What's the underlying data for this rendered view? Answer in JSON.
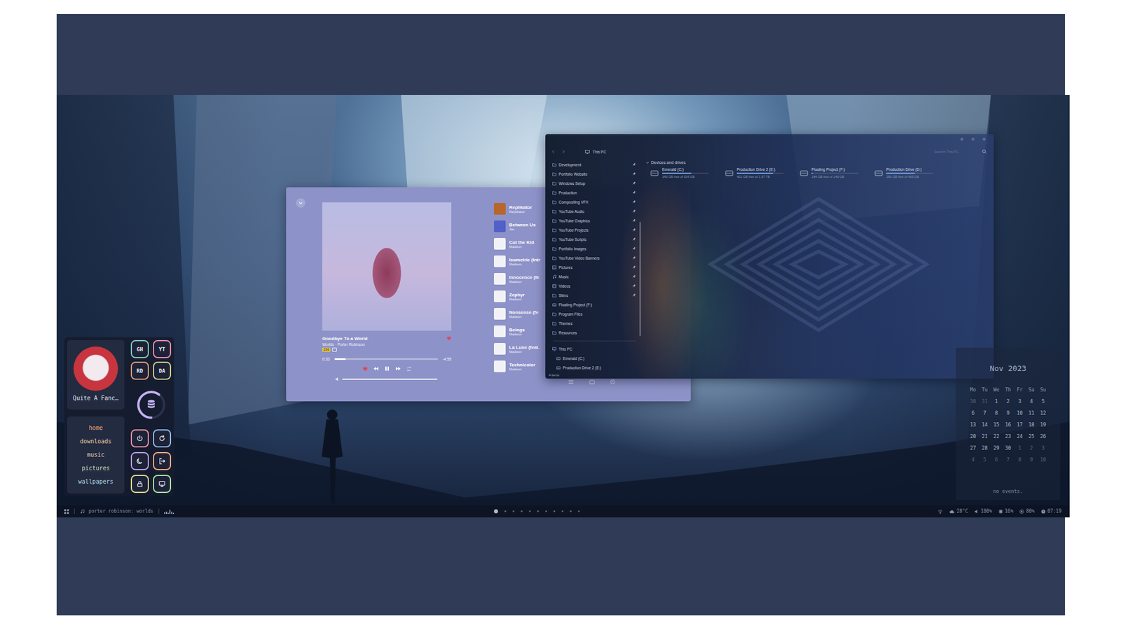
{
  "panel": {
    "profile": {
      "name": "Quite A Fanc…"
    },
    "links": [
      {
        "label": "GH",
        "color": "#7fc9b8"
      },
      {
        "label": "YT",
        "color": "#e58aab"
      },
      {
        "label": "RD",
        "color": "#e39a72"
      },
      {
        "label": "DA",
        "color": "#c6cf88"
      }
    ],
    "storage": {
      "level": 0.6
    },
    "nav": [
      {
        "label": "home",
        "color": "#eba67c"
      },
      {
        "label": "downloads",
        "color": "#e9c9a1"
      },
      {
        "label": "music",
        "color": "#ead3b0"
      },
      {
        "label": "pictures",
        "color": "#d5dcb3"
      },
      {
        "label": "wallpapers",
        "color": "#b3d9e4"
      }
    ],
    "session_buttons": [
      {
        "color": "#e98fa3"
      },
      {
        "color": "#8fb6e8"
      },
      {
        "color": "#b59fe2"
      },
      {
        "color": "#e9a97e"
      },
      {
        "color": "#d7d88f"
      },
      {
        "color": "#a6dfa0"
      }
    ]
  },
  "player": {
    "title": "Goodbye To a World",
    "subtitle": "Worlds · Porter Robinson",
    "badge": "256",
    "liked": true,
    "playing": true,
    "elapsed": "0:33",
    "remaining": "-4:55",
    "progress": 0.11,
    "volume": 1,
    "queue": [
      {
        "title": "Replikator",
        "subtitle": "Replikator",
        "color": "#b8662c"
      },
      {
        "title": "Between Us",
        "subtitle": "Jax",
        "color": "#5260c8"
      },
      {
        "title": "Cut the Kid",
        "subtitle": "Madeon",
        "color": "#f2f2f6"
      },
      {
        "title": "Isometric (Intr",
        "subtitle": "Madeon",
        "color": "#f2f2f6"
      },
      {
        "title": "Innocence (fe",
        "subtitle": "Madeon",
        "color": "#f2f2f6"
      },
      {
        "title": "Zephyr",
        "subtitle": "Madeon",
        "color": "#f2f2f6"
      },
      {
        "title": "Nonsense (fe",
        "subtitle": "Madeon",
        "color": "#f2f2f6"
      },
      {
        "title": "Beings",
        "subtitle": "Madeon",
        "color": "#f2f2f6"
      },
      {
        "title": "La Lune (feat.",
        "subtitle": "Madeon",
        "color": "#f2f2f6"
      },
      {
        "title": "Technicolor",
        "subtitle": "Madeon",
        "color": "#f2f2f6"
      }
    ]
  },
  "explorer": {
    "path": "This PC",
    "search": {
      "placeholder": "Search This PC"
    },
    "sidebar": [
      {
        "label": "Development",
        "kind": "folder",
        "pinned": true
      },
      {
        "label": "Portfolio Website",
        "kind": "folder",
        "pinned": true
      },
      {
        "label": "Windows Setup",
        "kind": "folder",
        "pinned": true
      },
      {
        "label": "Production",
        "kind": "folder",
        "pinned": true
      },
      {
        "label": "Compositing VFX",
        "kind": "folder",
        "pinned": true
      },
      {
        "label": "YouTube Audio",
        "kind": "folder",
        "pinned": true
      },
      {
        "label": "YouTube Graphics",
        "kind": "folder",
        "pinned": true
      },
      {
        "label": "YouTube Projects",
        "kind": "folder",
        "pinned": true
      },
      {
        "label": "YouTube Scripts",
        "kind": "folder",
        "pinned": true
      },
      {
        "label": "Portfolio Images",
        "kind": "folder",
        "pinned": true
      },
      {
        "label": "YouTube Video Banners",
        "kind": "folder",
        "pinned": true
      },
      {
        "label": "Pictures",
        "kind": "pictures",
        "pinned": true
      },
      {
        "label": "Music",
        "kind": "music",
        "pinned": true
      },
      {
        "label": "Videos",
        "kind": "videos",
        "pinned": true
      },
      {
        "label": "Skins",
        "kind": "folder",
        "pinned": true
      },
      {
        "label": "Floating Project (F:)",
        "kind": "drive",
        "pinned": false
      },
      {
        "label": "Program Files",
        "kind": "folder",
        "pinned": false
      },
      {
        "label": "Themes",
        "kind": "folder",
        "pinned": false
      },
      {
        "label": "Resources",
        "kind": "folder",
        "pinned": false
      }
    ],
    "sidebar_drives": [
      {
        "label": "This PC",
        "kind": "pc"
      },
      {
        "label": "Emerald (C:)",
        "kind": "drive"
      },
      {
        "label": "Production Drive 2 (E:)",
        "kind": "drive"
      }
    ],
    "section": {
      "label": "Devices and drives",
      "expanded": true
    },
    "drives": [
      {
        "name": "Emerald (C:)",
        "free": "345 GB free of 936 GB",
        "level": 0.63
      },
      {
        "name": "Production Drive 2 (E:)",
        "free": "401 GB free of 1.67 TB",
        "level": 0.77
      },
      {
        "name": "Floating Project (F:)",
        "free": "144 GB free of 149 GB",
        "level": 0.03
      },
      {
        "name": "Production Drive (D:)",
        "free": "180 GB free of 465 GB",
        "level": 0.61
      }
    ],
    "status": "4 items"
  },
  "calendar": {
    "title": "Nov 2023",
    "weekdays": [
      "Mo",
      "Tu",
      "We",
      "Th",
      "Fr",
      "Sa",
      "Su"
    ],
    "weeks": [
      [
        {
          "day": "30",
          "current": false
        },
        {
          "day": "31",
          "current": false
        },
        {
          "day": "1",
          "current": true
        },
        {
          "day": "2",
          "current": true
        },
        {
          "day": "3",
          "current": true
        },
        {
          "day": "4",
          "current": true
        },
        {
          "day": "5",
          "current": true
        }
      ],
      [
        {
          "day": "6",
          "current": true
        },
        {
          "day": "7",
          "current": true
        },
        {
          "day": "8",
          "current": true
        },
        {
          "day": "9",
          "current": true
        },
        {
          "day": "10",
          "current": true
        },
        {
          "day": "11",
          "current": true
        },
        {
          "day": "12",
          "current": true
        }
      ],
      [
        {
          "day": "13",
          "current": true
        },
        {
          "day": "14",
          "current": true
        },
        {
          "day": "15",
          "current": true
        },
        {
          "day": "16",
          "current": true
        },
        {
          "day": "17",
          "current": true
        },
        {
          "day": "18",
          "current": true
        },
        {
          "day": "19",
          "current": true
        }
      ],
      [
        {
          "day": "20",
          "current": true
        },
        {
          "day": "21",
          "current": true
        },
        {
          "day": "22",
          "current": true
        },
        {
          "day": "23",
          "current": true
        },
        {
          "day": "24",
          "current": true
        },
        {
          "day": "25",
          "current": true
        },
        {
          "day": "26",
          "current": true
        }
      ],
      [
        {
          "day": "27",
          "current": true
        },
        {
          "day": "28",
          "current": true
        },
        {
          "day": "29",
          "current": true
        },
        {
          "day": "30",
          "current": true
        },
        {
          "day": "1",
          "current": false
        },
        {
          "day": "2",
          "current": false
        },
        {
          "day": "3",
          "current": false
        }
      ],
      [
        {
          "day": "4",
          "current": false
        },
        {
          "day": "5",
          "current": false
        },
        {
          "day": "6",
          "current": false
        },
        {
          "day": "7",
          "current": false
        },
        {
          "day": "8",
          "current": false
        },
        {
          "day": "9",
          "current": false
        },
        {
          "day": "10",
          "current": false
        }
      ]
    ],
    "events_text": "no events."
  },
  "taskbar": {
    "separator": "|",
    "now_playing": "porter robinson: worlds",
    "visualizer": [
      0.3,
      0.5,
      0.25,
      0.8,
      0.45,
      0.2
    ],
    "workspaces": [
      {
        "selected": true
      },
      {
        "selected": false
      },
      {
        "selected": false
      },
      {
        "selected": false
      },
      {
        "selected": false
      },
      {
        "selected": false
      },
      {
        "selected": false
      },
      {
        "selected": false
      },
      {
        "selected": false
      },
      {
        "selected": false
      },
      {
        "selected": false
      }
    ],
    "status": [
      {
        "kind": "weather",
        "text": "28°C"
      },
      {
        "kind": "volume",
        "text": "100%"
      },
      {
        "kind": "cpu",
        "text": "16%"
      },
      {
        "kind": "memory",
        "text": "80%"
      },
      {
        "kind": "clock",
        "text": "07:19"
      }
    ]
  }
}
